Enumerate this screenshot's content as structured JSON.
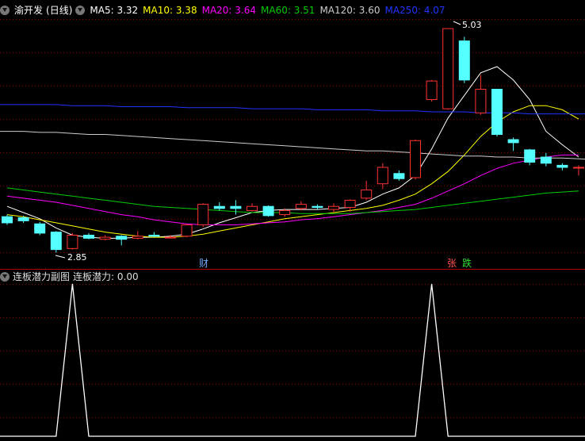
{
  "stock_name": "渝开发",
  "period": "(日线)",
  "ma_legend": [
    {
      "label": "MA5: 3.32",
      "color": "#ffffff"
    },
    {
      "label": "MA10: 3.38",
      "color": "#ffff00"
    },
    {
      "label": "MA20: 3.64",
      "color": "#ff00ff"
    },
    {
      "label": "MA60: 3.51",
      "color": "#00cc00"
    },
    {
      "label": "MA120: 3.60",
      "color": "#cccccc"
    },
    {
      "label": "MA250: 4.07",
      "color": "#2233ff"
    }
  ],
  "markers": {
    "high_label": "5.03",
    "low_label": "2.85",
    "cai": "财",
    "zhang": "张",
    "die": "跌"
  },
  "sub_panel": {
    "title": "连板潜力副图",
    "value_label": "连板潜力: 0.00"
  },
  "colors": {
    "up": "#ff3232",
    "down": "#54ffff",
    "grid": "#8b0000",
    "separator": "#b00000"
  },
  "chart_data": {
    "type": "candlestick",
    "ylim": [
      2.8,
      5.1
    ],
    "candles": [
      {
        "o": 3.2,
        "c": 3.14,
        "h": 3.22,
        "l": 3.12
      },
      {
        "o": 3.19,
        "c": 3.16,
        "h": 3.21,
        "l": 3.14
      },
      {
        "o": 3.13,
        "c": 3.04,
        "h": 3.15,
        "l": 3.02
      },
      {
        "o": 3.05,
        "c": 2.88,
        "h": 3.06,
        "l": 2.85
      },
      {
        "o": 2.89,
        "c": 3.02,
        "h": 3.04,
        "l": 2.88
      },
      {
        "o": 3.02,
        "c": 2.99,
        "h": 3.04,
        "l": 2.98
      },
      {
        "o": 2.98,
        "c": 3.0,
        "h": 3.02,
        "l": 2.97
      },
      {
        "o": 3.01,
        "c": 2.98,
        "h": 3.02,
        "l": 2.92
      },
      {
        "o": 2.99,
        "c": 3.01,
        "h": 3.06,
        "l": 2.98
      },
      {
        "o": 3.02,
        "c": 3.01,
        "h": 3.05,
        "l": 3.0
      },
      {
        "o": 3.0,
        "c": 3.0,
        "h": 3.02,
        "l": 2.99
      },
      {
        "o": 3.01,
        "c": 3.12,
        "h": 3.13,
        "l": 3.0
      },
      {
        "o": 3.12,
        "c": 3.32,
        "h": 3.33,
        "l": 3.1
      },
      {
        "o": 3.3,
        "c": 3.28,
        "h": 3.34,
        "l": 3.26
      },
      {
        "o": 3.3,
        "c": 3.28,
        "h": 3.36,
        "l": 3.22
      },
      {
        "o": 3.26,
        "c": 3.3,
        "h": 3.33,
        "l": 3.25
      },
      {
        "o": 3.3,
        "c": 3.21,
        "h": 3.31,
        "l": 3.2
      },
      {
        "o": 3.22,
        "c": 3.26,
        "h": 3.28,
        "l": 3.2
      },
      {
        "o": 3.28,
        "c": 3.32,
        "h": 3.35,
        "l": 3.26
      },
      {
        "o": 3.3,
        "c": 3.29,
        "h": 3.32,
        "l": 3.27
      },
      {
        "o": 3.27,
        "c": 3.3,
        "h": 3.33,
        "l": 3.24
      },
      {
        "o": 3.29,
        "c": 3.36,
        "h": 3.37,
        "l": 3.25
      },
      {
        "o": 3.38,
        "c": 3.46,
        "h": 3.55,
        "l": 3.36
      },
      {
        "o": 3.52,
        "c": 3.68,
        "h": 3.72,
        "l": 3.47
      },
      {
        "o": 3.62,
        "c": 3.57,
        "h": 3.65,
        "l": 3.55
      },
      {
        "o": 3.58,
        "c": 3.94,
        "h": 3.95,
        "l": 3.56
      },
      {
        "o": 4.34,
        "c": 4.52,
        "h": 4.53,
        "l": 4.32
      },
      {
        "o": 4.25,
        "c": 5.03,
        "h": 5.03,
        "l": 4.24
      },
      {
        "o": 4.91,
        "c": 4.53,
        "h": 4.95,
        "l": 4.5
      },
      {
        "o": 4.21,
        "c": 4.44,
        "h": 4.58,
        "l": 4.19
      },
      {
        "o": 4.44,
        "c": 4.0,
        "h": 4.44,
        "l": 3.98
      },
      {
        "o": 3.95,
        "c": 3.92,
        "h": 3.97,
        "l": 3.84
      },
      {
        "o": 3.85,
        "c": 3.73,
        "h": 3.86,
        "l": 3.7
      },
      {
        "o": 3.78,
        "c": 3.72,
        "h": 3.82,
        "l": 3.69
      },
      {
        "o": 3.7,
        "c": 3.68,
        "h": 3.72,
        "l": 3.65
      },
      {
        "o": 3.68,
        "c": 3.68,
        "h": 3.7,
        "l": 3.6
      }
    ],
    "ma_series": [
      {
        "name": "MA5",
        "color": "#ffffff",
        "values": [
          3.3,
          3.24,
          3.18,
          3.09,
          3.02,
          3.0,
          2.99,
          2.99,
          3.0,
          3.0,
          3.01,
          3.03,
          3.08,
          3.14,
          3.19,
          3.24,
          3.26,
          3.27,
          3.27,
          3.27,
          3.28,
          3.29,
          3.34,
          3.42,
          3.48,
          3.6,
          3.86,
          4.16,
          4.38,
          4.6,
          4.66,
          4.53,
          4.34,
          4.03,
          3.9,
          3.78
        ]
      },
      {
        "name": "MA10",
        "color": "#ffff00",
        "values": [
          3.22,
          3.2,
          3.17,
          3.14,
          3.11,
          3.08,
          3.05,
          3.03,
          3.01,
          3.0,
          3.0,
          3.01,
          3.03,
          3.06,
          3.09,
          3.12,
          3.15,
          3.18,
          3.2,
          3.22,
          3.24,
          3.26,
          3.28,
          3.31,
          3.36,
          3.42,
          3.52,
          3.64,
          3.8,
          3.98,
          4.12,
          4.22,
          4.28,
          4.28,
          4.24,
          4.15
        ]
      },
      {
        "name": "MA20",
        "color": "#ff00ff",
        "values": [
          3.4,
          3.38,
          3.36,
          3.34,
          3.31,
          3.28,
          3.25,
          3.22,
          3.2,
          3.17,
          3.15,
          3.13,
          3.12,
          3.12,
          3.12,
          3.13,
          3.14,
          3.15,
          3.17,
          3.18,
          3.2,
          3.22,
          3.24,
          3.26,
          3.29,
          3.32,
          3.38,
          3.45,
          3.52,
          3.6,
          3.67,
          3.72,
          3.75,
          3.78,
          3.8,
          3.8
        ]
      },
      {
        "name": "MA60",
        "color": "#00cc00",
        "values": [
          3.48,
          3.46,
          3.44,
          3.42,
          3.4,
          3.38,
          3.36,
          3.34,
          3.32,
          3.3,
          3.29,
          3.28,
          3.27,
          3.26,
          3.25,
          3.24,
          3.24,
          3.24,
          3.23,
          3.23,
          3.23,
          3.23,
          3.24,
          3.25,
          3.26,
          3.27,
          3.29,
          3.31,
          3.33,
          3.35,
          3.37,
          3.39,
          3.41,
          3.43,
          3.44,
          3.45
        ]
      },
      {
        "name": "MA120",
        "color": "#cccccc",
        "values": [
          4.03,
          4.03,
          4.02,
          4.02,
          4.01,
          4.0,
          4.0,
          3.99,
          3.98,
          3.97,
          3.96,
          3.95,
          3.94,
          3.93,
          3.92,
          3.91,
          3.9,
          3.89,
          3.88,
          3.87,
          3.86,
          3.85,
          3.84,
          3.84,
          3.83,
          3.82,
          3.81,
          3.8,
          3.79,
          3.79,
          3.78,
          3.78,
          3.77,
          3.77,
          3.77,
          3.76
        ]
      },
      {
        "name": "MA250",
        "color": "#2233ff",
        "values": [
          4.29,
          4.29,
          4.29,
          4.29,
          4.28,
          4.28,
          4.28,
          4.27,
          4.27,
          4.27,
          4.27,
          4.26,
          4.26,
          4.26,
          4.26,
          4.25,
          4.25,
          4.25,
          4.25,
          4.24,
          4.24,
          4.24,
          4.24,
          4.23,
          4.23,
          4.23,
          4.22,
          4.22,
          4.22,
          4.21,
          4.21,
          4.21,
          4.2,
          4.2,
          4.2,
          4.2
        ]
      }
    ],
    "sub_chart": {
      "name": "连板潜力",
      "ylim": [
        0,
        1
      ],
      "values": [
        0,
        0,
        0,
        0,
        1,
        0,
        0,
        0,
        0,
        0,
        0,
        0,
        0,
        0,
        0,
        0,
        0,
        0,
        0,
        0,
        0,
        0,
        0,
        0,
        0,
        0,
        1,
        0,
        0,
        0,
        0,
        0,
        0,
        0,
        0,
        0
      ]
    }
  }
}
